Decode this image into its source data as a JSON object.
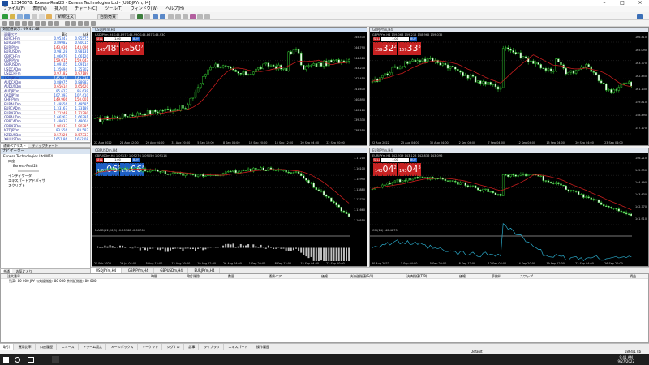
{
  "window": {
    "title": "12345678: Exness-Real28 - Exness Technologies Ltd - [USDJPYm,H4]"
  },
  "menu": [
    "ファイル(F)",
    "表示(V)",
    "挿入(I)",
    "チャート(C)",
    "ツール(T)",
    "ウィンドウ(W)",
    "ヘルプ(H)"
  ],
  "toolbar": {
    "new_order": "新規注文",
    "autotrade": "自動売買"
  },
  "market_watch": {
    "title": "気配値表示: 09:41:48",
    "col_symbol": "通貨ペア",
    "col_bid": "Bid",
    "col_ask": "Ask",
    "rows": [
      {
        "s": "EURCHFm",
        "b": "0.95347",
        "a": "0.95575",
        "d": "up"
      },
      {
        "s": "EURGBPm",
        "b": "0.89982",
        "a": "0.90015",
        "d": "up"
      },
      {
        "s": "EURJPYm",
        "b": "143.036",
        "a": "143.096",
        "d": "dn"
      },
      {
        "s": "EURUSDm",
        "b": "0.98128",
        "a": "0.98131",
        "d": "up"
      },
      {
        "s": "GBPCHFm",
        "b": "1.06079",
        "a": "1.06120",
        "d": "up"
      },
      {
        "s": "GBPJPYm",
        "b": "159.015",
        "a": "159.043",
        "d": "dn"
      },
      {
        "s": "GBPUSDm",
        "b": "1.09105",
        "a": "1.09114",
        "d": "up"
      },
      {
        "s": "USDCADm",
        "b": "1.35694",
        "a": "1.35702",
        "d": "up"
      },
      {
        "s": "USDCHFm",
        "b": "0.97182",
        "a": "0.97189",
        "d": "dn"
      },
      {
        "s": "USDJPYm",
        "b": "145.730",
        "a": "145.736",
        "d": "up"
      },
      {
        "s": "AUDCADm",
        "b": "0.88975",
        "a": "0.88983",
        "d": "up"
      },
      {
        "s": "AUDUSDm",
        "b": "0.65614",
        "a": "0.65620",
        "d": "dn"
      },
      {
        "s": "AUDJPYm",
        "b": "95.627",
        "a": "95.639",
        "d": "up"
      },
      {
        "s": "CADJPYm",
        "b": "107.393",
        "a": "107.410",
        "d": "up"
      },
      {
        "s": "CHFJPYm",
        "b": "149.966",
        "a": "150.001",
        "d": "dn"
      },
      {
        "s": "EURAUDm",
        "b": "1.49556",
        "a": "1.49585",
        "d": "up"
      },
      {
        "s": "EURCADm",
        "b": "1.33167",
        "a": "1.33189",
        "d": "up"
      },
      {
        "s": "EURNZDm",
        "b": "1.71248",
        "a": "1.71290",
        "d": "dn"
      },
      {
        "s": "GBPAUDm",
        "b": "1.66262",
        "a": "1.66291",
        "d": "up"
      },
      {
        "s": "GBPCADm",
        "b": "1.48037",
        "a": "1.48064",
        "d": "up"
      },
      {
        "s": "GBPNZDm",
        "b": "1.90333",
        "a": "1.90385",
        "d": "dn"
      },
      {
        "s": "NZDJPYm",
        "b": "83.556",
        "a": "83.583",
        "d": "up"
      },
      {
        "s": "NZDUSDm",
        "b": "0.57326",
        "a": "0.57333",
        "d": "dn"
      },
      {
        "s": "XAUUSDm",
        "b": "1651.86",
        "a": "1652.08",
        "d": "up"
      }
    ],
    "selected_index": 9,
    "tabs": [
      "通貨ペアリスト",
      "ティックチャート"
    ]
  },
  "navigator": {
    "title": "ナビゲーター",
    "items": [
      "Exness Technologies Ltd MT4",
      "口座",
      "Exness-Real28",
      "インディケータ",
      "エキスパートアドバイザ",
      "スクリプト"
    ],
    "tabs": [
      "共通",
      "お気に入り"
    ]
  },
  "charts": [
    {
      "title": "USDJPYm,H4",
      "sym": "USDJPYm,H4 144.897 144.990 144.867 144.930",
      "sell": "145",
      "sell_big": "48",
      "sell_sup": "4",
      "buy": "145",
      "buy_big": "50",
      "buy_sup": "7",
      "lot": "1.00",
      "prices": [
        "145.570",
        "144.790",
        "144.010",
        "143.230",
        "142.450",
        "141.670",
        "140.890",
        "140.110",
        "139.330",
        "138.550"
      ],
      "times": [
        "22 Aug 2022",
        "24 Aug 12:00",
        "29 Aug 04:00",
        "31 Aug 20:00",
        "5 Sep 12:00",
        "8 Sep 04:00",
        "12 Sep 20:00",
        "15 Sep 12:00",
        "20 Sep 04:00",
        "22 Sep 20:00"
      ],
      "active": true
    },
    {
      "title": "GBPJPYm,H4",
      "sym": "GBPJPYm,H4 159.063 159.215 158.965 159.035",
      "sell": "159",
      "sell_big": "32",
      "sell_sup": "2",
      "buy": "159",
      "buy_big": "33",
      "buy_sup": "3",
      "lot": "1.00",
      "prices": [
        "166.410",
        "165.090",
        "163.770",
        "162.450",
        "161.130",
        "159.810",
        "158.490",
        "157.170"
      ],
      "times": [
        "22 Aug 2022",
        "25 Aug 04:00",
        "30 Aug 04:00",
        "2 Sep 04:00",
        "7 Sep 04:00",
        "12 Sep 04:00",
        "15 Sep 04:00",
        "20 Sep 04:00",
        "23 Sep 04:00"
      ],
      "active": false
    },
    {
      "title": "GBPUSDm,H4",
      "sym": "GBPUSDm,H4 1.09132 1.09276 1.09050 1.09114",
      "sell": "1.09",
      "sell_big": "06",
      "sell_sup": "6",
      "buy": "1.09",
      "buy_big": "06",
      "buy_sup": "8",
      "lot": "1.00",
      "prices": [
        "1.17210",
        "1.16100",
        "1.14990",
        "1.13880",
        "1.12770",
        "1.11660",
        "1.10550"
      ],
      "macd": "MACD(12,26,9) -0.00968 -0.00765",
      "times": [
        "25 Feb 2022",
        "29 Jul 04:00",
        "5 Aug 12:00",
        "12 Aug 20:00",
        "19 Aug 12:00",
        "26 Aug 04:00",
        "1 Sep 20:00",
        "8 Sep 12:00",
        "15 Sep 04:00",
        "22 Sep 20:00"
      ],
      "active": false
    },
    {
      "title": "EURJPYm,H4",
      "sym": "EURJPYm,H4 142.939 143.128 142.836 143.096",
      "sell": "143",
      "sell_big": "04",
      "sell_sup": "2",
      "buy": "143",
      "buy_big": "04",
      "buy_sup": "3",
      "lot": "1.00",
      "prices": [
        "146.210",
        "145.350",
        "144.490",
        "143.630",
        "142.770",
        "141.910"
      ],
      "macd": "CCI(14) -40.4875",
      "times": [
        "30 Aug 2022",
        "1 Sep 04:00",
        "5 Sep 20:00",
        "8 Sep 12:00",
        "12 Sep 04:00",
        "14 Sep 20:00",
        "19 Sep 12:00",
        "22 Sep 04:00",
        "26 Sep 20:00"
      ],
      "active": false
    }
  ],
  "chart_tabs": [
    "USDJPYm,H4",
    "GBPJPYm,H4",
    "GBPUSDm,H4",
    "EURJPYm,H4"
  ],
  "terminal": {
    "headers": [
      "注文番号",
      "時間",
      "取引種別",
      "数量",
      "通貨ペア",
      "価格",
      "決済逆指値(S/L)",
      "決済指値(T/P)",
      "価格",
      "手数料",
      "スワップ",
      "損益"
    ],
    "balance": "残高: 80 000 JPY  有効証拠金: 80 000  余剰証拠金: 80 000"
  },
  "terminal_tabs": [
    "取引",
    "運用比率",
    "口座履歴",
    "ニュース",
    "アラーム設定",
    "メールボックス",
    "マーケット",
    "シグナル",
    "記事",
    "ライブラリ",
    "エキスパート",
    "操作履歴"
  ],
  "status": {
    "profile": "Default",
    "bytes": "1864/1 kb"
  },
  "taskbar": {
    "time": "9:41 AM",
    "date": "9/27/2022"
  }
}
